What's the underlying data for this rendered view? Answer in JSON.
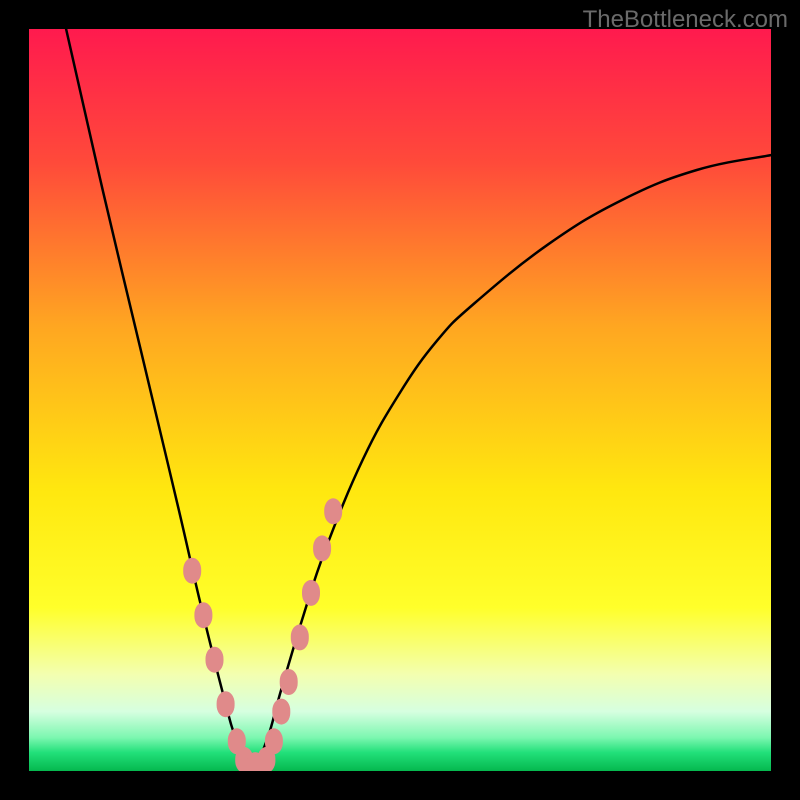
{
  "watermark": "TheBottleneck.com",
  "chart_data": {
    "type": "line",
    "title": "",
    "xlabel": "",
    "ylabel": "",
    "xlim": [
      0,
      100
    ],
    "ylim": [
      0,
      100
    ],
    "grid": false,
    "optimum_x": 30,
    "curve_note": "V-shaped bottleneck curve; minimum near x≈30; steep left branch, shallow right branch",
    "series": [
      {
        "name": "bottleneck-curve",
        "color": "#000000",
        "x": [
          5,
          10,
          15,
          20,
          23,
          26,
          28,
          30,
          32,
          34,
          37,
          40,
          45,
          50,
          55,
          60,
          70,
          80,
          90,
          100
        ],
        "y": [
          100,
          78,
          57,
          36,
          23,
          11,
          4,
          0.5,
          4,
          11,
          21,
          30,
          42,
          51,
          58,
          63,
          71,
          77,
          81,
          83
        ]
      }
    ],
    "markers": {
      "name": "highlighted-points",
      "color": "#e08a8a",
      "points": [
        {
          "x": 22.0,
          "y": 27
        },
        {
          "x": 23.5,
          "y": 21
        },
        {
          "x": 25.0,
          "y": 15
        },
        {
          "x": 26.5,
          "y": 9
        },
        {
          "x": 28.0,
          "y": 4
        },
        {
          "x": 29.0,
          "y": 1.5
        },
        {
          "x": 30.5,
          "y": 0.8
        },
        {
          "x": 32.0,
          "y": 1.5
        },
        {
          "x": 33.0,
          "y": 4
        },
        {
          "x": 34.0,
          "y": 8
        },
        {
          "x": 35.0,
          "y": 12
        },
        {
          "x": 36.5,
          "y": 18
        },
        {
          "x": 38.0,
          "y": 24
        },
        {
          "x": 39.5,
          "y": 30
        },
        {
          "x": 41.0,
          "y": 35
        }
      ]
    },
    "background_gradient": {
      "stops": [
        {
          "pos": 0.0,
          "color": "#ff1a4e"
        },
        {
          "pos": 0.18,
          "color": "#ff4a3a"
        },
        {
          "pos": 0.4,
          "color": "#ffa621"
        },
        {
          "pos": 0.62,
          "color": "#ffe70f"
        },
        {
          "pos": 0.78,
          "color": "#ffff2a"
        },
        {
          "pos": 0.87,
          "color": "#f3ffb0"
        },
        {
          "pos": 0.92,
          "color": "#d6ffe0"
        },
        {
          "pos": 0.955,
          "color": "#7cf7b0"
        },
        {
          "pos": 0.975,
          "color": "#22e07a"
        },
        {
          "pos": 1.0,
          "color": "#05b84e"
        }
      ]
    }
  }
}
